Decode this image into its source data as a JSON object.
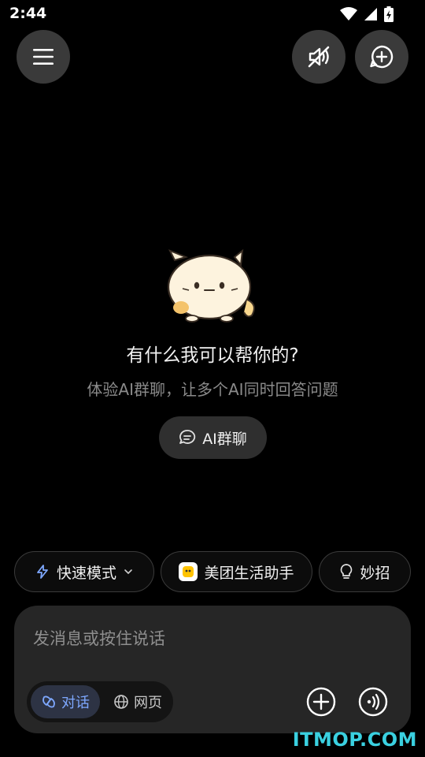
{
  "status_bar": {
    "time": "2:44"
  },
  "hero": {
    "title": "有什么我可以帮你的?",
    "subtitle": "体验AI群聊，让多个AI同时回答问题",
    "group_chat_button": "AI群聊"
  },
  "chips": {
    "fast_mode": "快速模式",
    "meituan": "美团生活助手",
    "tips": "妙招"
  },
  "composer": {
    "placeholder": "发消息或按住说话",
    "mode_chat": "对话",
    "mode_web": "网页"
  },
  "watermark": "ITMOP.COM",
  "colors": {
    "background": "#000000",
    "accent": "#7ea8ff",
    "watermark": "#3ad0e0"
  }
}
